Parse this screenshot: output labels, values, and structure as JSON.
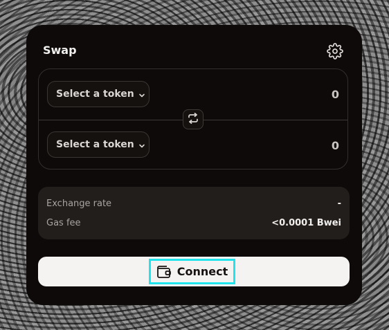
{
  "swap": {
    "title": "Swap",
    "from_token_label": "Select a token",
    "from_amount": "0",
    "to_token_label": "Select a token",
    "to_amount": "0"
  },
  "details": {
    "exchange_rate_label": "Exchange rate",
    "exchange_rate_value": "-",
    "gas_fee_label": "Gas fee",
    "gas_fee_value": "<0.0001 Bwei"
  },
  "actions": {
    "connect_label": "Connect"
  },
  "icons": {
    "settings": "gear-icon",
    "token_dropdown": "chevron-down-icon",
    "flip": "swap-arrows-icon",
    "wallet": "wallet-icon"
  },
  "colors": {
    "card_bg": "#0d0a09",
    "info_bg": "#221e1c",
    "connect_bg": "#f5f3f1",
    "focus_ring": "#1ee4ee"
  }
}
